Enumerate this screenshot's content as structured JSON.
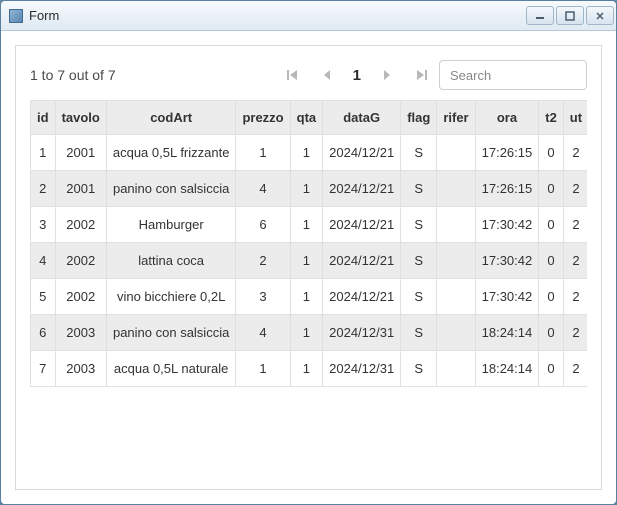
{
  "window": {
    "title": "Form"
  },
  "pager": {
    "range_label": "1 to 7 out of 7",
    "current_page": "1",
    "search_placeholder": "Search"
  },
  "table": {
    "columns": [
      "id",
      "tavolo",
      "codArt",
      "prezzo",
      "qta",
      "dataG",
      "flag",
      "rifer",
      "ora",
      "t2",
      "ut"
    ],
    "rows": [
      {
        "id": "1",
        "tavolo": "2001",
        "codArt": "acqua 0,5L frizzante",
        "prezzo": "1",
        "qta": "1",
        "dataG": "2024/12/21",
        "flag": "S",
        "rifer": "",
        "ora": "17:26:15",
        "t2": "0",
        "ut": "2"
      },
      {
        "id": "2",
        "tavolo": "2001",
        "codArt": "panino con salsiccia",
        "prezzo": "4",
        "qta": "1",
        "dataG": "2024/12/21",
        "flag": "S",
        "rifer": "",
        "ora": "17:26:15",
        "t2": "0",
        "ut": "2"
      },
      {
        "id": "3",
        "tavolo": "2002",
        "codArt": "Hamburger",
        "prezzo": "6",
        "qta": "1",
        "dataG": "2024/12/21",
        "flag": "S",
        "rifer": "",
        "ora": "17:30:42",
        "t2": "0",
        "ut": "2"
      },
      {
        "id": "4",
        "tavolo": "2002",
        "codArt": "lattina coca",
        "prezzo": "2",
        "qta": "1",
        "dataG": "2024/12/21",
        "flag": "S",
        "rifer": "",
        "ora": "17:30:42",
        "t2": "0",
        "ut": "2"
      },
      {
        "id": "5",
        "tavolo": "2002",
        "codArt": "vino bicchiere 0,2L",
        "prezzo": "3",
        "qta": "1",
        "dataG": "2024/12/21",
        "flag": "S",
        "rifer": "",
        "ora": "17:30:42",
        "t2": "0",
        "ut": "2"
      },
      {
        "id": "6",
        "tavolo": "2003",
        "codArt": "panino con salsiccia",
        "prezzo": "4",
        "qta": "1",
        "dataG": "2024/12/31",
        "flag": "S",
        "rifer": "",
        "ora": "18:24:14",
        "t2": "0",
        "ut": "2"
      },
      {
        "id": "7",
        "tavolo": "2003",
        "codArt": "acqua 0,5L naturale",
        "prezzo": "1",
        "qta": "1",
        "dataG": "2024/12/31",
        "flag": "S",
        "rifer": "",
        "ora": "18:24:14",
        "t2": "0",
        "ut": "2"
      }
    ]
  }
}
